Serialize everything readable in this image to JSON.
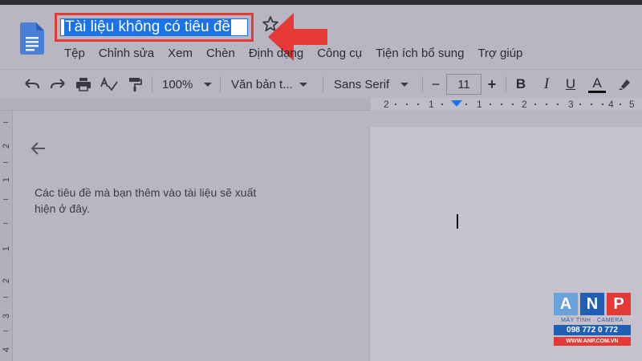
{
  "document": {
    "title": "Tài liệu không có tiêu đề"
  },
  "menu": {
    "items": [
      "Tệp",
      "Chỉnh sửa",
      "Xem",
      "Chèn",
      "Định dạng",
      "Công cụ",
      "Tiện ích bổ sung",
      "Trợ giúp"
    ]
  },
  "toolbar": {
    "zoom": "100%",
    "style": "Văn bản t...",
    "font": "Sans Serif",
    "font_size": "11",
    "minus": "−",
    "plus": "+",
    "bold": "B",
    "italic": "I",
    "underline": "U",
    "text_color": "A"
  },
  "ruler": {
    "labels": [
      "2",
      "1",
      "1",
      "2",
      "3",
      "4",
      "5"
    ]
  },
  "vertical_ruler": {
    "labels": [
      "2",
      "1",
      "1",
      "2",
      "3",
      "4"
    ]
  },
  "outline": {
    "hint": "Các tiêu đề mà bạn thêm vào tài liệu sẽ xuất hiện ở đây."
  },
  "watermark": {
    "letters": [
      "A",
      "N",
      "P"
    ],
    "tagline": "MÁY TÍNH · CAMERA",
    "phone": "098 772 0 772",
    "website": "WWW.ANP.COM.VN"
  },
  "colors": {
    "highlight": "#1a73e8",
    "annotation": "#e53935",
    "docs_blue": "#4285f4"
  }
}
